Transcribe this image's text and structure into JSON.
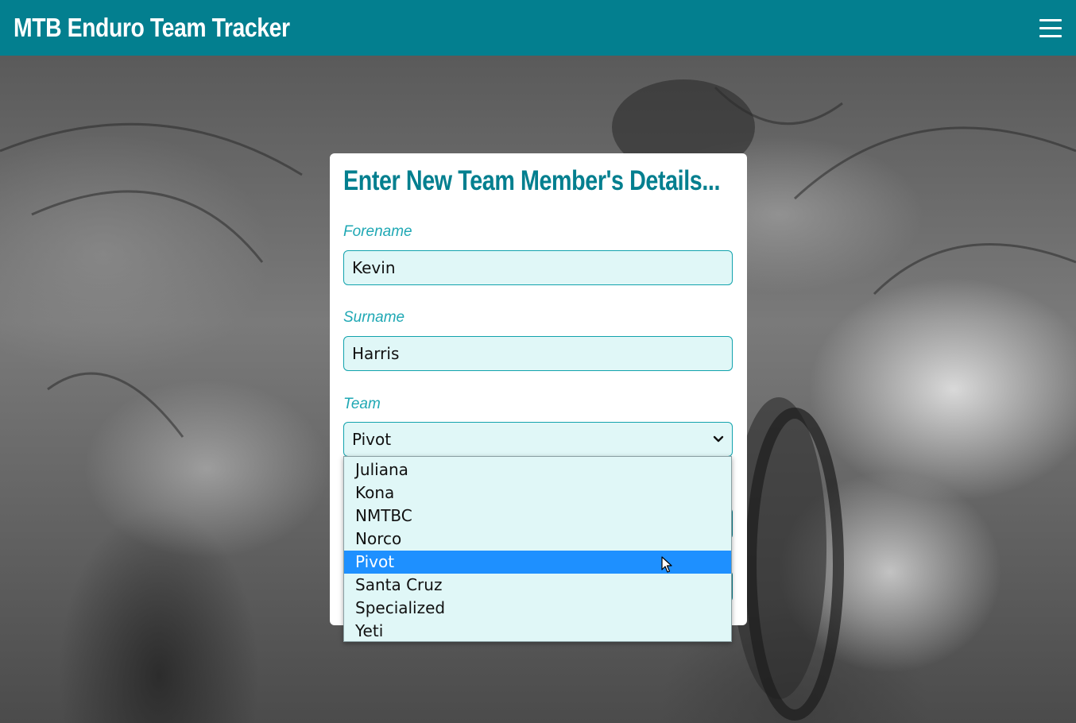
{
  "header": {
    "title": "MTB Enduro Team Tracker",
    "menu_icon": "hamburger-menu-icon",
    "background_color": "#037f8f"
  },
  "form": {
    "heading": "Enter New Team Member's Details...",
    "forename": {
      "label": "Forename",
      "value": "Kevin"
    },
    "surname": {
      "label": "Surname",
      "value": "Harris"
    },
    "team": {
      "label": "Team",
      "selected": "Pivot",
      "options": [
        "Juliana",
        "Kona",
        "NMTBC",
        "Norco",
        "Pivot",
        "Santa Cruz",
        "Specialized",
        "Yeti"
      ]
    }
  },
  "colors": {
    "accent": "#037f8f",
    "label": "#1fa8b4",
    "input_bg": "#e0f7f7",
    "highlight": "#1e90ff"
  }
}
